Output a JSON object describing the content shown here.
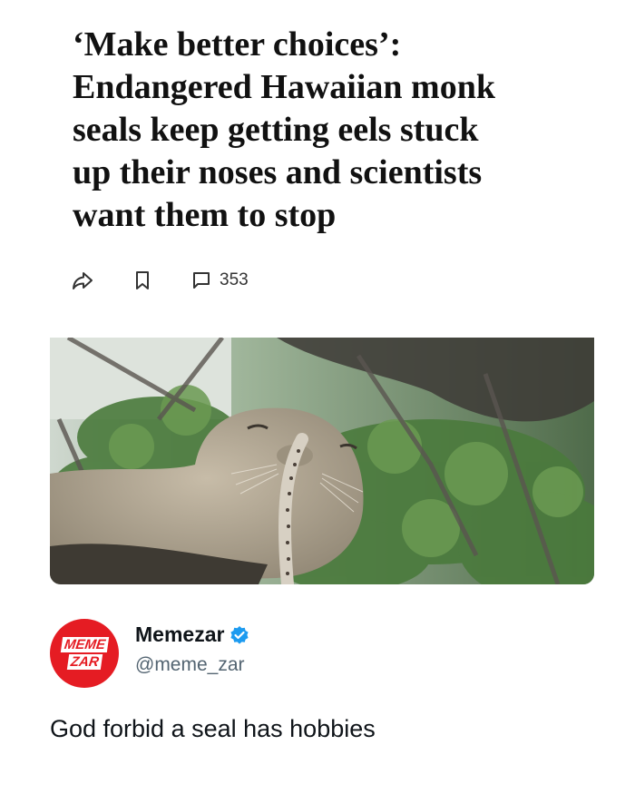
{
  "headline": {
    "line1": "‘Make better choices’:",
    "line2": "Endangered Hawaiian monk",
    "line3": "seals keep getting eels stuck",
    "line4": "up their noses and scientists",
    "line5": "want them to stop"
  },
  "actions": {
    "share_icon": "share-arrow-icon",
    "bookmark_icon": "bookmark-icon",
    "comment_icon": "comment-icon",
    "comment_count": "353"
  },
  "photo": {
    "subject": "monk-seal-with-eel-photo"
  },
  "profile": {
    "avatar_line1": "MEME",
    "avatar_line2": "ZAR",
    "avatar_color": "#e51c23",
    "display_name": "Memezar",
    "handle": "@meme_zar",
    "verified_color": "#1d9bf0"
  },
  "tweet": {
    "text": "God forbid a seal has hobbies"
  }
}
